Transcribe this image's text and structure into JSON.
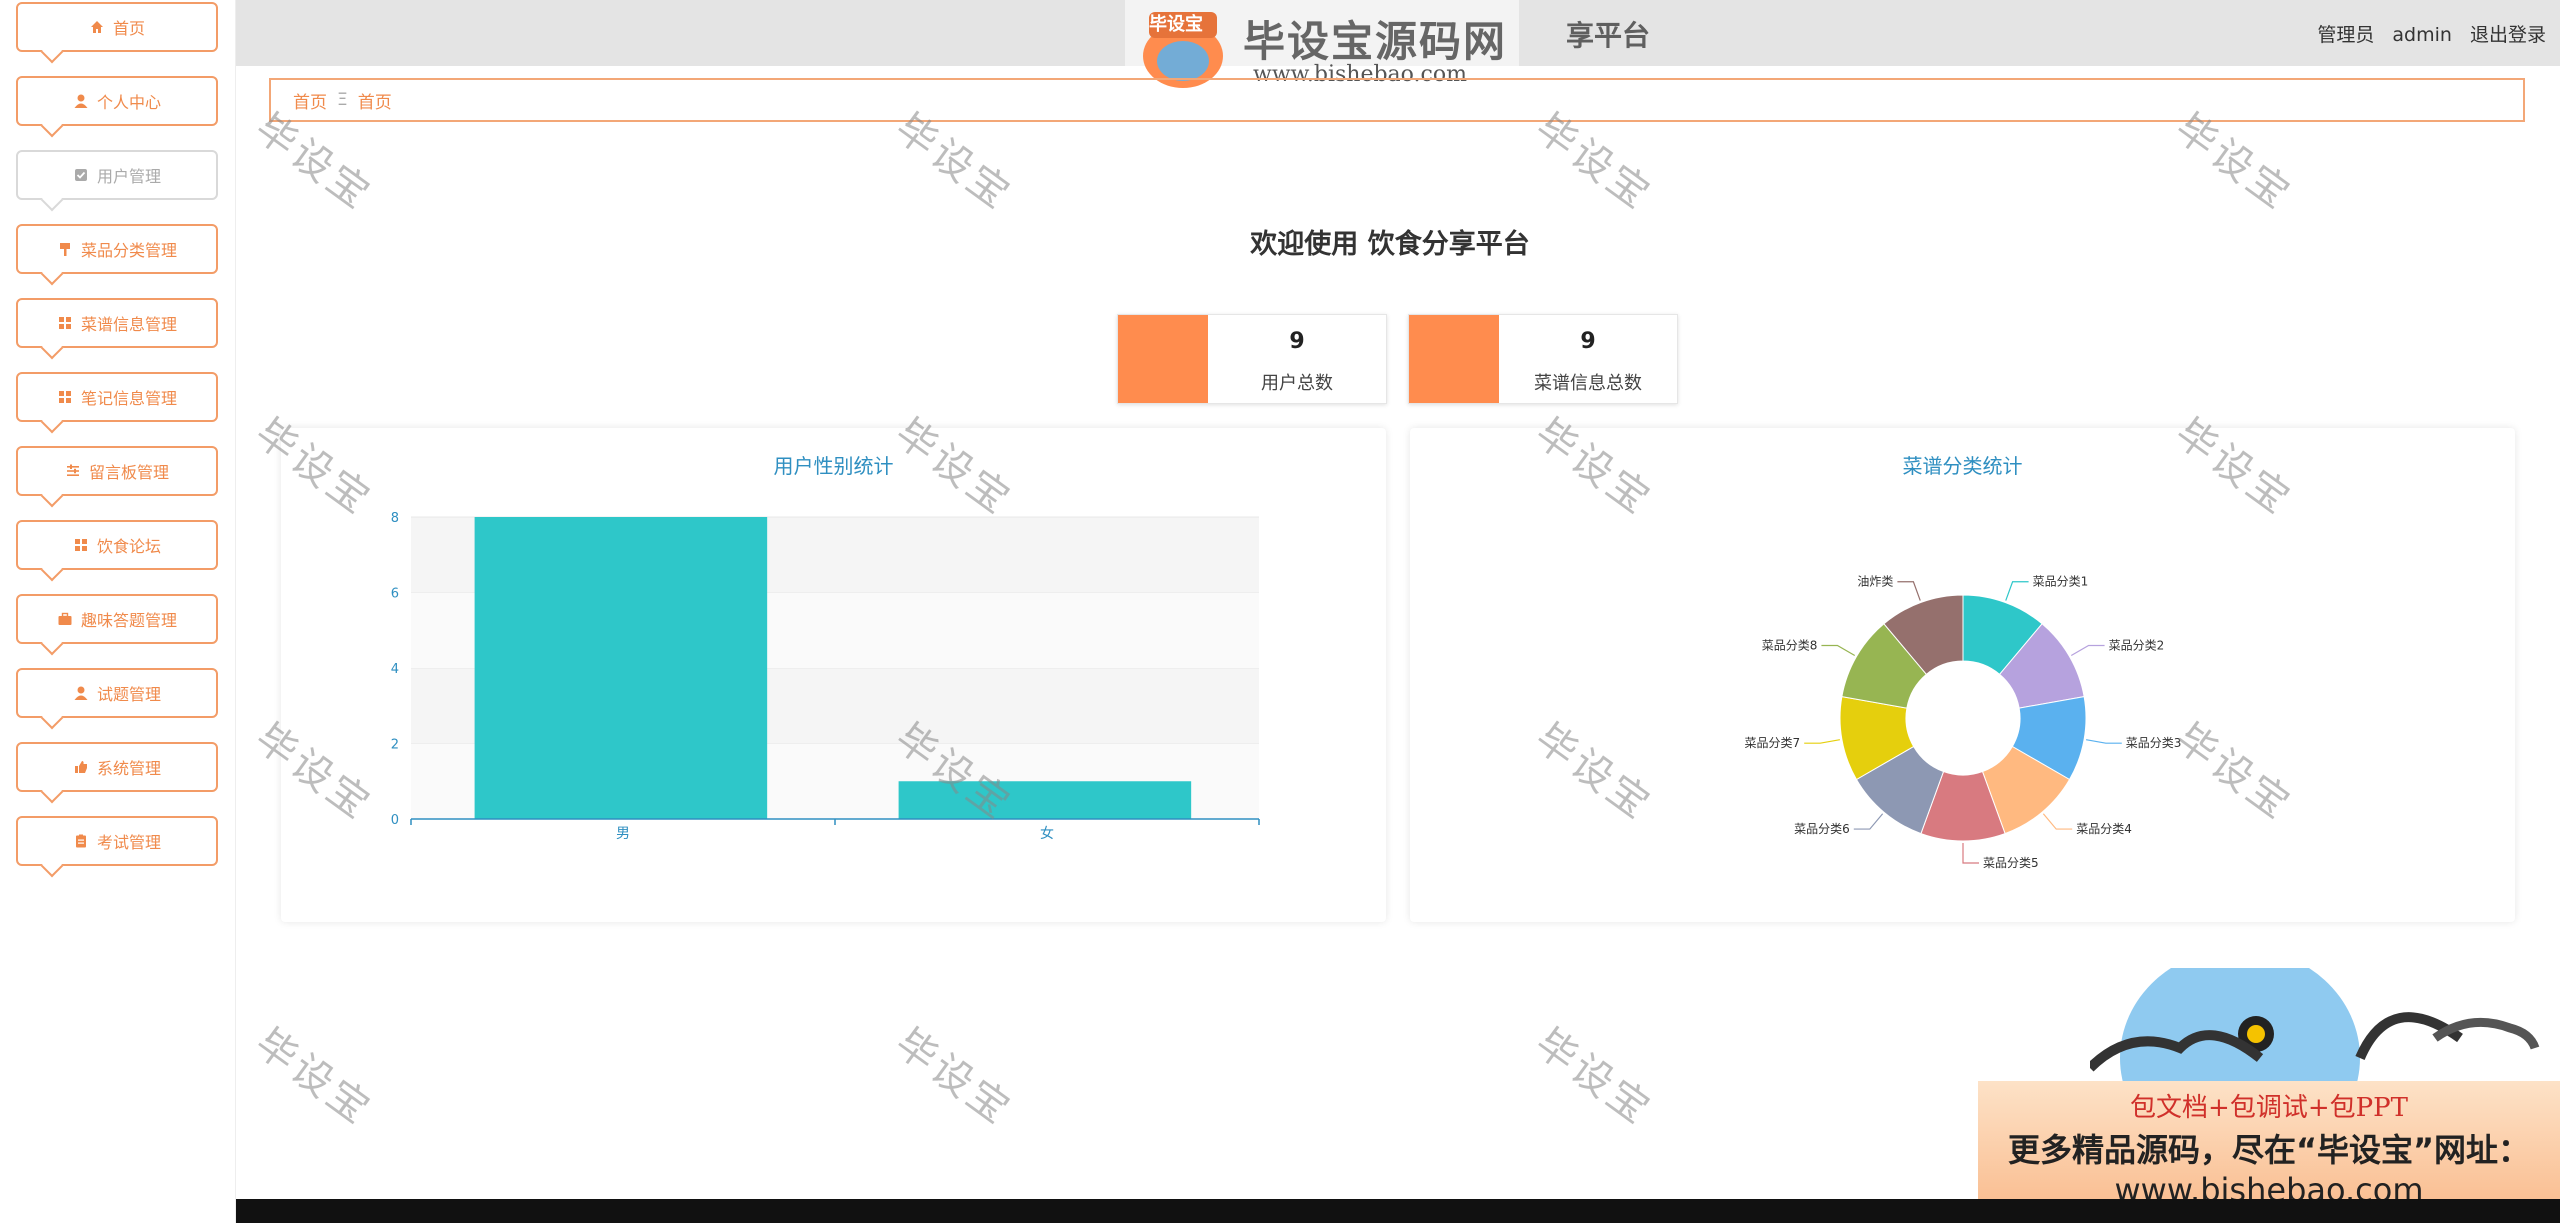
{
  "sidebar": {
    "items": [
      {
        "label": "首页",
        "icon": "home-icon"
      },
      {
        "label": "个人中心",
        "icon": "user-icon"
      },
      {
        "label": "用户管理",
        "icon": "checkbox-icon"
      },
      {
        "label": "菜品分类管理",
        "icon": "brush-icon"
      },
      {
        "label": "菜谱信息管理",
        "icon": "grid-icon"
      },
      {
        "label": "笔记信息管理",
        "icon": "grid-icon"
      },
      {
        "label": "留言板管理",
        "icon": "sliders-icon"
      },
      {
        "label": "饮食论坛",
        "icon": "grid-icon"
      },
      {
        "label": "趣味答题管理",
        "icon": "briefcase-icon"
      },
      {
        "label": "试题管理",
        "icon": "user-icon"
      },
      {
        "label": "系统管理",
        "icon": "thumb-icon"
      },
      {
        "label": "考试管理",
        "icon": "clipboard-icon"
      }
    ],
    "active_index": 2
  },
  "header": {
    "title_fragment": "享平台",
    "role": "管理员",
    "username": "admin",
    "logout": "退出登录",
    "logo": {
      "badge": "毕设宝",
      "title": "毕设宝源码网",
      "url": "www.bishebao.com"
    }
  },
  "breadcrumb": {
    "home": "首页",
    "separator": "Ξ",
    "current": "首页"
  },
  "welcome": "欢迎使用 饮食分享平台",
  "stats": [
    {
      "value": "9",
      "label": "用户总数",
      "color": "#ff8c4e"
    },
    {
      "value": "9",
      "label": "菜谱信息总数",
      "color": "#ff8c4e"
    }
  ],
  "watermark_text": "毕设宝",
  "ad": {
    "line1": "包文档+包调试+包PPT",
    "line2": "更多精品源码，尽在“毕设宝”网址：",
    "line3": "www.bishebao.com"
  },
  "chart_data": [
    {
      "type": "bar",
      "title": "用户性别统计",
      "categories": [
        "男",
        "女"
      ],
      "values": [
        8,
        1
      ],
      "ylim": [
        0,
        8
      ],
      "yticks": [
        0,
        2,
        4,
        6,
        8
      ],
      "color": "#2ec7c9"
    },
    {
      "type": "pie",
      "title": "菜谱分类统计",
      "donut": true,
      "labels": [
        "菜品分类1",
        "菜品分类2",
        "菜品分类3",
        "菜品分类4",
        "菜品分类5",
        "菜品分类6",
        "菜品分类7",
        "菜品分类8",
        "油炸类"
      ],
      "values": [
        1,
        1,
        1,
        1,
        1,
        1,
        1,
        1,
        1
      ],
      "colors": [
        "#2ec7c9",
        "#b6a2de",
        "#5ab1ef",
        "#ffb980",
        "#d87a80",
        "#8d98b3",
        "#e5cf0d",
        "#97b552",
        "#95706d"
      ]
    }
  ]
}
